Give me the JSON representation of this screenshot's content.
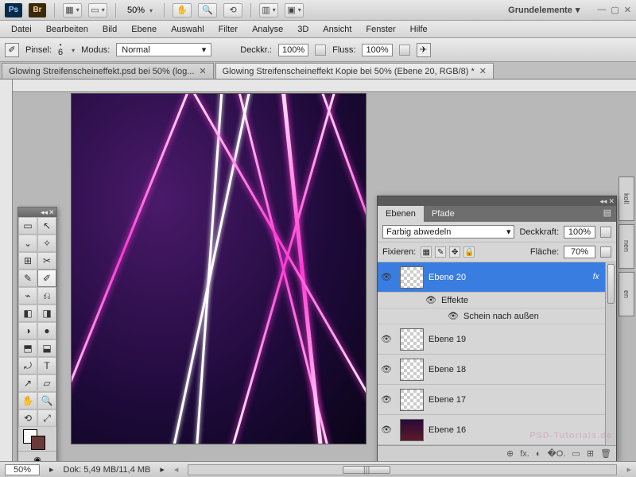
{
  "appbar": {
    "ps": "Ps",
    "br": "Br",
    "zoom": "50%",
    "workspace": "Grundelemente"
  },
  "menu": [
    "Datei",
    "Bearbeiten",
    "Bild",
    "Ebene",
    "Auswahl",
    "Filter",
    "Analyse",
    "3D",
    "Ansicht",
    "Fenster",
    "Hilfe"
  ],
  "options": {
    "brush_label": "Pinsel:",
    "brush_size": "6",
    "mode_label": "Modus:",
    "mode_value": "Normal",
    "opacity_label": "Deckkr.:",
    "opacity_value": "100%",
    "flow_label": "Fluss:",
    "flow_value": "100%"
  },
  "tabs": [
    {
      "label": "Glowing Streifenscheineffekt.psd bei 50% (log...",
      "active": false
    },
    {
      "label": "Glowing Streifenscheineffekt Kopie bei 50% (Ebene 20, RGB/8) *",
      "active": true
    }
  ],
  "tools": [
    "▭",
    "↖",
    "⌄",
    "✧",
    "⊞",
    "✂",
    "✎",
    "✐",
    "⌁",
    "⎌",
    "◧",
    "◨",
    "◑",
    "●",
    "⬒",
    "⬓",
    "⤾",
    "T",
    "↗",
    "▱",
    "✋",
    "🔍",
    "⟲",
    "⤢"
  ],
  "layers_panel": {
    "tab_layers": "Ebenen",
    "tab_paths": "Pfade",
    "blend_mode": "Farbig abwedeln",
    "opacity_label": "Deckkraft:",
    "opacity_value": "100%",
    "lock_label": "Fixieren:",
    "fill_label": "Fläche:",
    "fill_value": "70%",
    "effects_label": "Effekte",
    "outer_glow": "Schein nach außen",
    "layers": [
      {
        "name": "Ebene 20",
        "selected": true,
        "fx": "fx"
      },
      {
        "name": "Ebene 19"
      },
      {
        "name": "Ebene 18"
      },
      {
        "name": "Ebene 17"
      },
      {
        "name": "Ebene 16",
        "dark": true
      }
    ],
    "footer_icons": [
      "⊕",
      "fx.",
      "◐",
      "�O.",
      "▭",
      "⊞",
      "🗑"
    ]
  },
  "status": {
    "zoom": "50%",
    "doc_info": "Dok: 5,49 MB/11,4 MB"
  },
  "right_dock": [
    "koll",
    "nen",
    "en"
  ],
  "watermark": "PSD-Tutorials.de"
}
